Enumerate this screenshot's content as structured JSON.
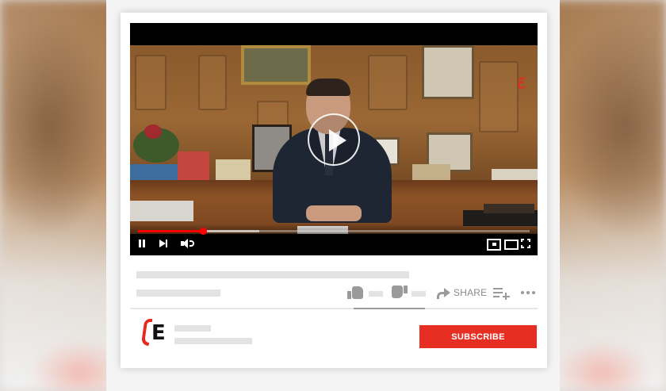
{
  "player": {
    "progress_played": 0.165,
    "progress_buffered": 0.31
  },
  "actions": {
    "share_label": "SHARE"
  },
  "channel": {
    "subscribe_label": "SUBSCRIBE"
  },
  "icons": [
    "play-icon",
    "pause-icon",
    "next-icon",
    "volume-icon",
    "miniplayer-icon",
    "theater-icon",
    "fullscreen-icon",
    "like-icon",
    "dislike-icon",
    "share-icon",
    "save-to-playlist-icon",
    "more-icon",
    "channel-logo"
  ],
  "colors": {
    "progress": "#ff0000",
    "subscribe": "#e62f22",
    "brand": "#e8281e"
  }
}
